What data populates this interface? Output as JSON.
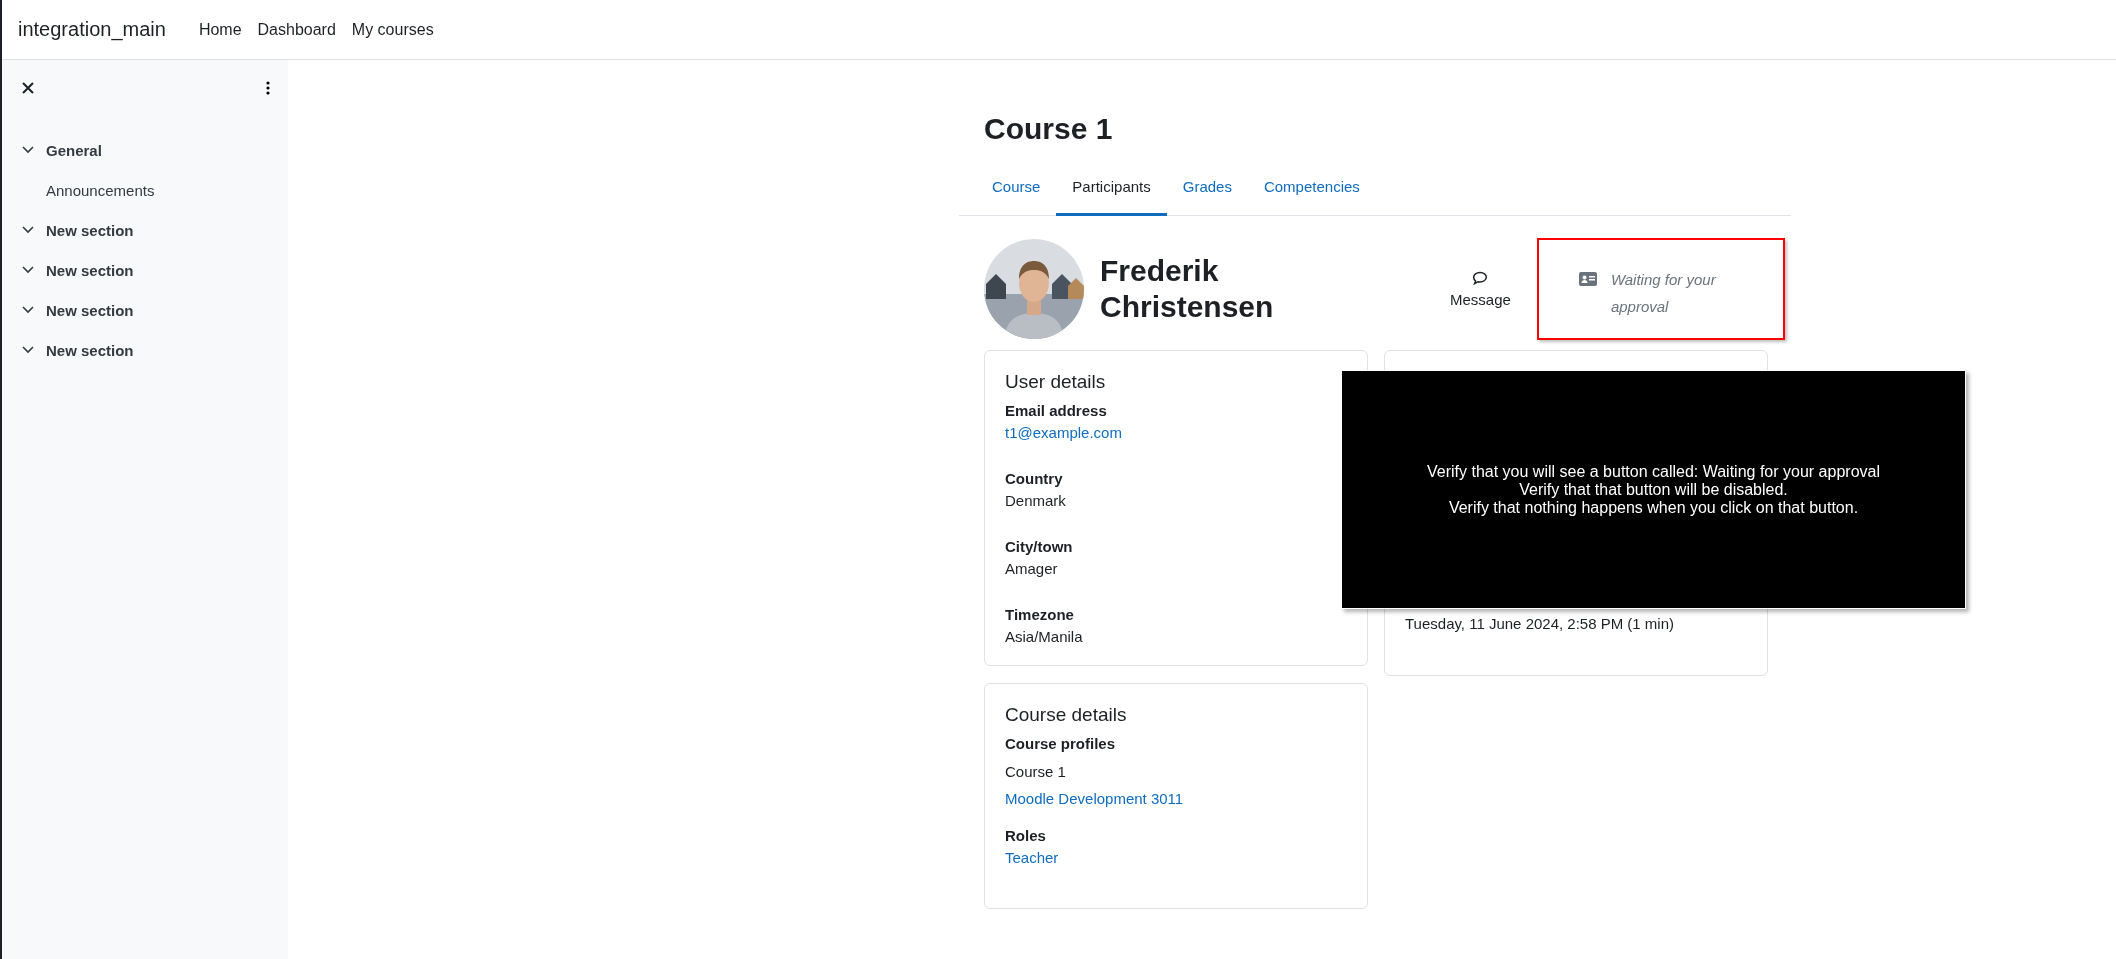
{
  "navbar": {
    "site_name": "integration_main",
    "links": [
      {
        "label": "Home"
      },
      {
        "label": "Dashboard"
      },
      {
        "label": "My courses"
      }
    ]
  },
  "sidebar": {
    "items": [
      {
        "label": "General",
        "kind": "section",
        "expanded": true
      },
      {
        "label": "Announcements",
        "kind": "activity"
      },
      {
        "label": "New section",
        "kind": "section",
        "expanded": true
      },
      {
        "label": "New section",
        "kind": "section",
        "expanded": true
      },
      {
        "label": "New section",
        "kind": "section",
        "expanded": true
      },
      {
        "label": "New section",
        "kind": "section",
        "expanded": true
      }
    ]
  },
  "page_title": "Course 1",
  "tabs": [
    {
      "label": "Course",
      "selected": false
    },
    {
      "label": "Participants",
      "selected": true
    },
    {
      "label": "Grades",
      "selected": false
    },
    {
      "label": "Competencies",
      "selected": false
    }
  ],
  "profile": {
    "name": "Frederik Christensen",
    "message_button": "Message",
    "approval_button": {
      "label": "Waiting for your approval",
      "disabled": true,
      "highlighted": true
    }
  },
  "user_details": {
    "title": "User details",
    "fields": [
      {
        "label": "Email address",
        "value": "t1@example.com",
        "kind": "link"
      },
      {
        "label": "Country",
        "value": "Denmark",
        "kind": "text"
      },
      {
        "label": "City/town",
        "value": "Amager",
        "kind": "text"
      },
      {
        "label": "Timezone",
        "value": "Asia/Manila",
        "kind": "text"
      }
    ]
  },
  "access_card": {
    "last_access_value": "Tuesday, 11 June 2024, 2:58 PM  (1 min)"
  },
  "course_details": {
    "title": "Course details",
    "profiles_label": "Course profiles",
    "profiles": [
      {
        "label": "Course 1",
        "kind": "text"
      },
      {
        "label": "Moodle Development 3011",
        "kind": "link"
      }
    ],
    "roles_label": "Roles",
    "roles": [
      {
        "label": "Teacher"
      }
    ]
  },
  "overlay": {
    "lines": [
      "Verify that you will see a button called: Waiting for your approval",
      "Verify that that button will be disabled.",
      "Verify that nothing happens when you click on that button."
    ]
  }
}
